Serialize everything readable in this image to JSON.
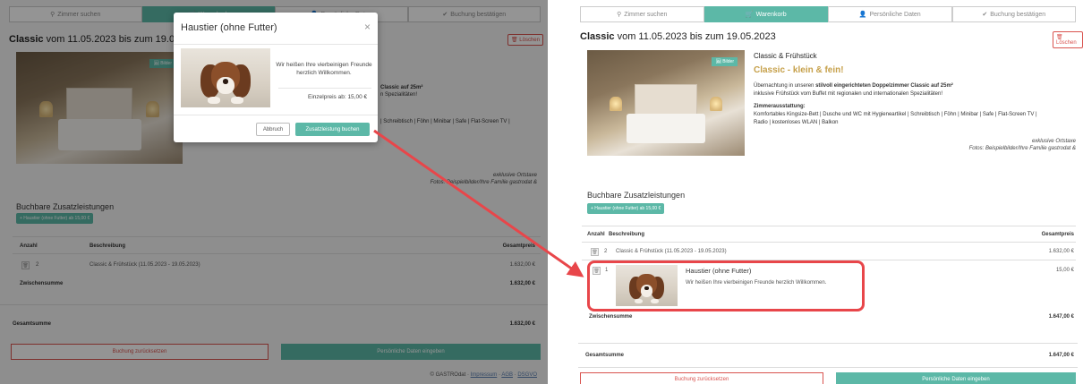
{
  "steps": [
    {
      "icon": "search-icon",
      "glyph": "⚲",
      "label": "Zimmer suchen"
    },
    {
      "icon": "cart-icon",
      "glyph": "🛒",
      "label": "Warenkorb"
    },
    {
      "icon": "user-icon",
      "glyph": "👤",
      "label": "Persönliche Daten"
    },
    {
      "icon": "check-icon",
      "glyph": "✔",
      "label": "Buchung bestätigen"
    }
  ],
  "room": {
    "title_prefix": "Classic",
    "title_rest": "vom 11.05.2023 bis zum 19.05.2023",
    "delete_label": "Löschen",
    "photo_badge": "Bilder",
    "category": "Classic & Frühstück",
    "slogan": "Classic - klein & fein!",
    "desc_pre": "Übernachtung in unseren",
    "desc_bold": "stilvoll eingerichteten Doppelzimmer Classic auf 25m²",
    "desc_line2": "inklusive Frühstück vom Buffet mit regionalen und internationalen Spezialitäten!",
    "equipment_title": "Zimmerausstattung:",
    "equipment_line1": "Komfortables Kingsize-Bett | Dusche und WC mit Hygieneartikel | Schreibtisch | Föhn | Minibar | Safe | Flat-Screen TV |",
    "equipment_line2": "Radio | kostenloses WLAN | Balkon",
    "left_desc_partial": "Classic auf 25m²",
    "left_desc_partial2": "n Spezialitäten!",
    "left_equipment_partial": "| Schreibtisch | Föhn | Minibar | Safe | Flat-Screen TV |",
    "caption_line1": "exklusive Ortstaxe",
    "caption_line2": "Fotos: Beispielbilder/Ihre Familie gastrodat &"
  },
  "extras": {
    "section_title": "Buchbare Zusatzleistungen",
    "pet_button_left": "+ Haustier (ohne Futter) ab 15,00 €",
    "pet_button_right": "+ Haustier (ohne Futter) ab 15,00 €"
  },
  "table": {
    "col_qty": "Anzahl",
    "col_desc": "Beschreibung",
    "col_total": "Gesamtpreis",
    "room_row": {
      "qty": "2",
      "desc": "Classic & Frühstück (11.05.2023 - 19.05.2023)",
      "price": "1.632,00 €"
    },
    "pet_row": {
      "qty": "1",
      "title": "Haustier (ohne Futter)",
      "desc": "Wir heißen Ihre vierbeinigen Freunde herzlich Willkommen.",
      "price": "15,00 €"
    },
    "subtotal_label": "Zwischensumme",
    "subtotal_left": "1.632,00 €",
    "subtotal_right": "1.647,00 €",
    "total_label": "Gesamtsumme",
    "total_left": "1.632,00 €",
    "total_right": "1.647,00 €"
  },
  "actions": {
    "reset_label": "Buchung zurücksetzen",
    "next_label": "Persönliche Daten eingeben"
  },
  "footer": {
    "prefix": "© GASTROdat",
    "link_imprint": "Impressum",
    "link_terms": "AGB",
    "link_privacy": "DSGVO"
  },
  "modal": {
    "title": "Haustier (ohne Futter)",
    "close_glyph": "×",
    "description": "Wir heißen Ihre vierbeinigen Freunde herzlich Willkommen.",
    "price": "Einzelpreis ab: 15,00 €",
    "cancel_label": "Abbruch",
    "book_label": "Zusatzleistung buchen"
  },
  "colors": {
    "accent": "#5cb8a7",
    "danger": "#d9534f",
    "highlight": "#e8464a",
    "gold": "#c6a04a"
  }
}
